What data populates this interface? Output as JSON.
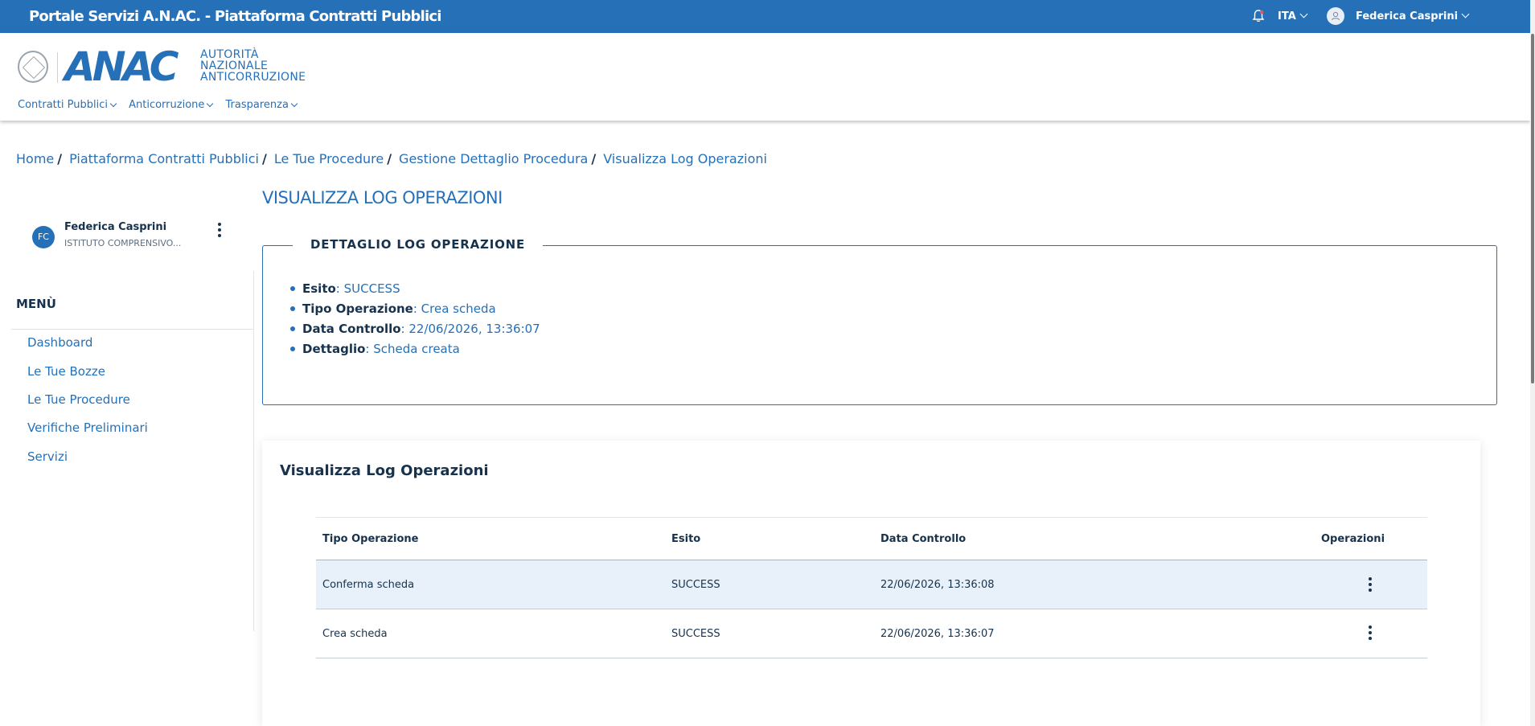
{
  "topbar": {
    "title": "Portale Servizi A.N.AC. - Piattaforma Contratti Pubblici",
    "language": "ITA",
    "user_name": "Federica Casprini"
  },
  "header": {
    "logo_text": "ANAC",
    "logo_caption": [
      "AUTORITÀ",
      "NAZIONALE",
      "ANTICORRUZIONE"
    ],
    "nav": [
      "Contratti Pubblici",
      "Anticorruzione",
      "Trasparenza"
    ]
  },
  "breadcrumb": {
    "items": [
      "Home",
      "Piattaforma Contratti Pubblici",
      "Le Tue Procedure",
      "Gestione Dettaglio Procedura"
    ],
    "current": "Visualizza Log Operazioni"
  },
  "sidebar": {
    "profile": {
      "initials": "FC",
      "name": "Federica Casprini",
      "organization": "ISTITUTO COMPRENSIVO..."
    },
    "menu_title": "MENÙ",
    "items": [
      "Dashboard",
      "Le Tue Bozze",
      "Le Tue Procedure",
      "Verifiche Preliminari",
      "Servizi"
    ]
  },
  "main": {
    "page_title": "VISUALIZZA LOG OPERAZIONI",
    "detail": {
      "legend": "DETTAGLIO LOG OPERAZIONE",
      "items": [
        {
          "label": "Esito",
          "value": ": SUCCESS"
        },
        {
          "label": "Tipo Operazione",
          "value": ": Crea scheda"
        },
        {
          "label": "Data Controllo",
          "value": ": 22/06/2026, 13:36:07"
        },
        {
          "label": "Dettaglio",
          "value": ": Scheda creata"
        }
      ]
    },
    "log_card": {
      "title": "Visualizza Log Operazioni",
      "columns": [
        "Tipo Operazione",
        "Esito",
        "Data Controllo",
        "Operazioni"
      ],
      "rows": [
        {
          "tipo": "Conferma scheda",
          "esito": "SUCCESS",
          "data": "22/06/2026, 13:36:08"
        },
        {
          "tipo": "Crea scheda",
          "esito": "SUCCESS",
          "data": "22/06/2026, 13:36:07"
        }
      ]
    }
  },
  "colors": {
    "brand_blue": "#2670b8",
    "text_dark": "#17324d",
    "row_highlight": "#e8f1f9"
  }
}
